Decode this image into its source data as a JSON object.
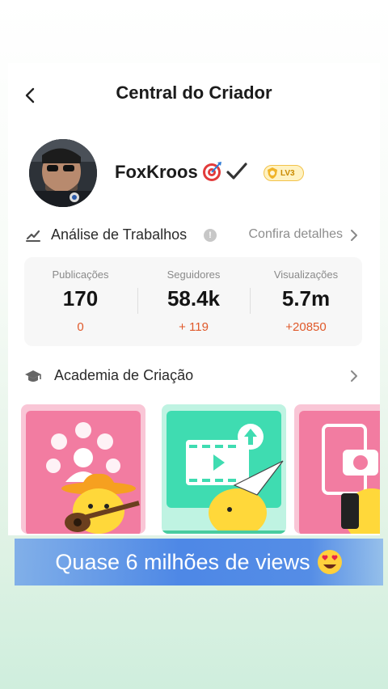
{
  "header": {
    "title": "Central do Criador",
    "back_icon": "chevron-left-icon"
  },
  "profile": {
    "username": "FoxKroos",
    "emojis": [
      "target-emoji",
      "check-mark-emoji"
    ],
    "level_badge": "LV3"
  },
  "analysis": {
    "icon": "trend-chart-icon",
    "title": "Análise de Trabalhos",
    "info_icon": "info-icon",
    "details_link": "Confira detalhes",
    "stats": [
      {
        "label": "Publicações",
        "value": "170",
        "delta": "0"
      },
      {
        "label": "Seguidores",
        "value": "58.4k",
        "delta": "+ 119"
      },
      {
        "label": "Visualizações",
        "value": "5.7m",
        "delta": "+20850"
      }
    ]
  },
  "academy": {
    "icon": "graduation-cap-icon",
    "title": "Academia de Criação",
    "cards": [
      {
        "theme": "pink",
        "illustration": "people-guitar-icon"
      },
      {
        "theme": "mint",
        "illustration": "video-upload-icon"
      },
      {
        "theme": "pink",
        "illustration": "photo-camera-icon"
      }
    ]
  },
  "caption": {
    "text": "Quase 6 milhões de views",
    "emoji": "heart-eyes-emoji"
  },
  "colors": {
    "accent_orange": "#e0592a",
    "caption_blue": "#4682e6",
    "card_pink": "#f47fa3",
    "card_mint": "#4fe0b8",
    "badge_gold": "#f2c34a"
  }
}
